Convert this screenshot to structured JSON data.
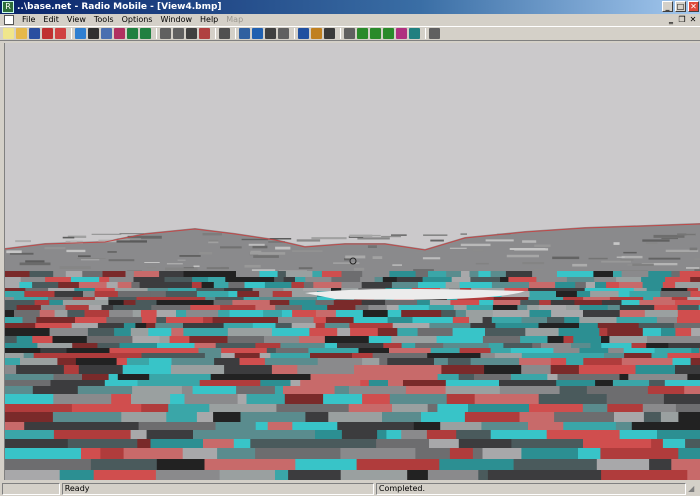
{
  "window": {
    "title": "..\\base.net - Radio Mobile - [View4.bmp]",
    "app_icon": "radio-mobile-app-icon",
    "controls": [
      "minimize",
      "maximize",
      "close"
    ]
  },
  "menu": {
    "items": [
      {
        "label": "File",
        "enabled": true
      },
      {
        "label": "Edit",
        "enabled": true
      },
      {
        "label": "View",
        "enabled": true
      },
      {
        "label": "Tools",
        "enabled": true
      },
      {
        "label": "Options",
        "enabled": true
      },
      {
        "label": "Window",
        "enabled": true
      },
      {
        "label": "Help",
        "enabled": true
      },
      {
        "label": "Map",
        "enabled": false
      }
    ],
    "mdi_controls": [
      "minimize",
      "restore",
      "close"
    ]
  },
  "toolbar": {
    "groups": [
      [
        {
          "name": "new-icon",
          "color": "#f0e68c"
        },
        {
          "name": "open-icon",
          "color": "#e6b84a"
        },
        {
          "name": "save-icon",
          "color": "#2b4fa0"
        },
        {
          "name": "network-properties-icon",
          "color": "#c03030"
        },
        {
          "name": "unit-properties-icon",
          "color": "#d04040"
        }
      ],
      [
        {
          "name": "globe-icon",
          "color": "#2f7fd0"
        },
        {
          "name": "map-properties-icon",
          "color": "#303030"
        },
        {
          "name": "earth-icon",
          "color": "#4a6fb0"
        },
        {
          "name": "picture-properties-icon",
          "color": "#b03060"
        },
        {
          "name": "step-left-icon",
          "color": "#208040"
        },
        {
          "name": "step-right-icon",
          "color": "#208040"
        }
      ],
      [
        {
          "name": "copy-icon",
          "color": "#606060"
        },
        {
          "name": "paste-icon",
          "color": "#606060"
        },
        {
          "name": "save-picture-icon",
          "color": "#404040"
        },
        {
          "name": "close-picture-icon",
          "color": "#b04040"
        }
      ],
      [
        {
          "name": "print-icon",
          "color": "#505050"
        }
      ],
      [
        {
          "name": "merge-pictures-icon",
          "color": "#3060a0"
        },
        {
          "name": "world-map-icon",
          "color": "#2060b0"
        },
        {
          "name": "zoom-window-icon",
          "color": "#404040"
        },
        {
          "name": "crosshair-icon",
          "color": "#606060"
        }
      ],
      [
        {
          "name": "radio-link-icon",
          "color": "#2050a0"
        },
        {
          "name": "find-best-site-icon",
          "color": "#c08020"
        },
        {
          "name": "radio-coverage-icon",
          "color": "#3a3a3a"
        }
      ],
      [
        {
          "name": "antenna-icon",
          "color": "#606060"
        },
        {
          "name": "polar-plot-icon",
          "color": "#2a8a2a"
        },
        {
          "name": "cartesian-plot-icon",
          "color": "#2a8a2a"
        },
        {
          "name": "combined-cartesian-icon",
          "color": "#2a8a2a"
        },
        {
          "name": "route-coverage-icon",
          "color": "#b03080"
        },
        {
          "name": "visual-coverage-icon",
          "color": "#208080"
        }
      ],
      [
        {
          "name": "exit-icon",
          "color": "#606060"
        }
      ]
    ]
  },
  "view": {
    "image": "anaglyph-3d-terrain-view",
    "sky_color": "#cbc9cb"
  },
  "status": {
    "left": "",
    "message": "Ready",
    "progress": "Completed."
  }
}
